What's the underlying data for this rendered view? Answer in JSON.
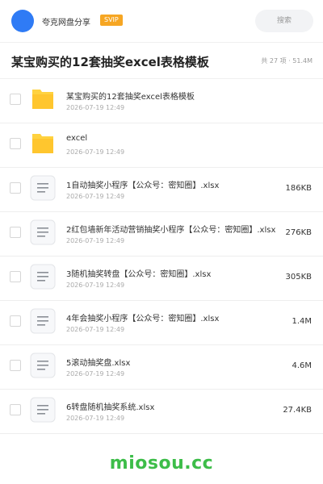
{
  "header": {
    "user_name": "夸克网盘分享",
    "badge": "SVIP",
    "search_label": "搜索",
    "avatar_color": "#2f7bf5"
  },
  "folder": {
    "title": "某宝购买的12套抽奖excel表格模板",
    "summary": "共 27 项 · 51.4M"
  },
  "files": [
    {
      "name": "某宝购买的12套抽奖excel表格模板",
      "date": "2026-07-19 12:49",
      "size": "",
      "type": "folder"
    },
    {
      "name": "excel",
      "date": "2026-07-19 12:49",
      "size": "",
      "type": "folder"
    },
    {
      "name": "1自动抽奖小程序【公众号：密知圈】.xlsx",
      "date": "2026-07-19 12:49",
      "size": "186KB",
      "type": "file"
    },
    {
      "name": "2红包墙新年活动营销抽奖小程序【公众号：密知圈】.xlsx",
      "date": "2026-07-19 12:49",
      "size": "276KB",
      "type": "file"
    },
    {
      "name": "3随机抽奖转盘【公众号：密知圈】.xlsx",
      "date": "2026-07-19 12:49",
      "size": "305KB",
      "type": "file"
    },
    {
      "name": "4年会抽奖小程序【公众号：密知圈】.xlsx",
      "date": "2026-07-19 12:49",
      "size": "1.4M",
      "type": "file"
    },
    {
      "name": "5滚动抽奖盘.xlsx",
      "date": "2026-07-19 12:49",
      "size": "4.6M",
      "type": "file"
    },
    {
      "name": "6转盘随机抽奖系统.xlsx",
      "date": "2026-07-19 12:49",
      "size": "27.4KB",
      "type": "file"
    }
  ],
  "watermark": "miosou.cc",
  "colors": {
    "folder_icon": "#ffc62e",
    "watermark": "#3dbd49",
    "svip_badge": "#f6a623"
  }
}
